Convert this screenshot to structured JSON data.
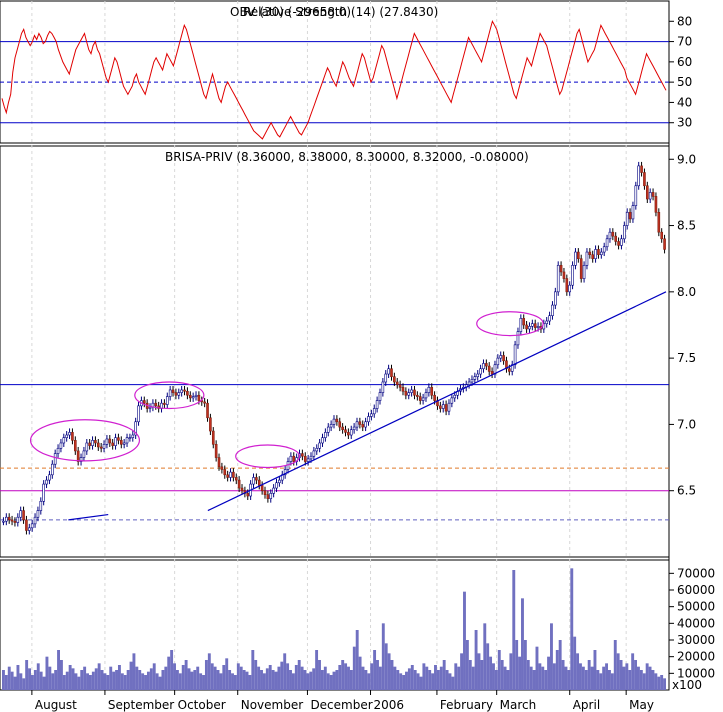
{
  "chart_data": [
    {
      "type": "line",
      "title": "Relative Strength (14) (27.8430)",
      "title_overlap": "OBV (30) (-29658.0)",
      "ylim": [
        20,
        90
      ],
      "yticks": [
        "80",
        "70",
        "60",
        "50",
        "40",
        "30"
      ],
      "reference_lines": [
        {
          "y": 70,
          "style": "solid",
          "color": "#0000c8"
        },
        {
          "y": 50,
          "style": "dashed",
          "color": "#0000c8"
        },
        {
          "y": 30,
          "style": "solid",
          "color": "#0000c8"
        }
      ],
      "series": [
        {
          "color": "#e00000",
          "values": [
            42,
            38,
            35,
            40,
            44,
            55,
            62,
            66,
            70,
            74,
            76,
            72,
            70,
            68,
            70,
            73,
            71,
            74,
            72,
            69,
            70,
            73,
            75,
            74,
            72,
            70,
            66,
            63,
            60,
            58,
            56,
            54,
            58,
            62,
            66,
            68,
            70,
            72,
            74,
            70,
            66,
            64,
            68,
            70,
            66,
            64,
            60,
            56,
            52,
            50,
            54,
            58,
            62,
            60,
            56,
            52,
            48,
            46,
            44,
            46,
            48,
            52,
            54,
            50,
            48,
            46,
            44,
            48,
            52,
            56,
            60,
            62,
            60,
            58,
            56,
            60,
            64,
            62,
            60,
            58,
            62,
            66,
            70,
            74,
            78,
            76,
            72,
            68,
            64,
            60,
            56,
            52,
            48,
            44,
            42,
            46,
            50,
            54,
            50,
            46,
            42,
            40,
            44,
            48,
            50,
            48,
            46,
            44,
            42,
            40,
            38,
            36,
            34,
            32,
            30,
            28,
            26,
            25,
            24,
            23,
            22,
            24,
            26,
            28,
            30,
            28,
            26,
            24,
            23,
            25,
            27,
            29,
            31,
            33,
            31,
            29,
            27,
            25,
            24,
            26,
            28,
            30,
            33,
            36,
            39,
            42,
            45,
            48,
            51,
            54,
            57,
            55,
            52,
            50,
            48,
            52,
            56,
            60,
            58,
            55,
            52,
            50,
            48,
            52,
            56,
            60,
            64,
            62,
            58,
            54,
            50,
            52,
            56,
            60,
            64,
            68,
            66,
            62,
            58,
            54,
            50,
            46,
            42,
            46,
            50,
            54,
            58,
            62,
            66,
            70,
            74,
            72,
            70,
            68,
            66,
            64,
            62,
            60,
            58,
            56,
            54,
            52,
            50,
            48,
            46,
            44,
            42,
            40,
            44,
            48,
            52,
            56,
            60,
            64,
            68,
            72,
            70,
            68,
            66,
            64,
            62,
            60,
            64,
            68,
            72,
            76,
            80,
            78,
            76,
            72,
            68,
            64,
            60,
            56,
            52,
            48,
            44,
            42,
            46,
            50,
            54,
            58,
            62,
            60,
            58,
            62,
            66,
            70,
            74,
            72,
            70,
            68,
            64,
            60,
            56,
            52,
            48,
            44,
            46,
            50,
            54,
            58,
            62,
            66,
            70,
            74,
            76,
            72,
            68,
            64,
            60,
            62,
            64,
            66,
            70,
            74,
            78,
            76,
            74,
            72,
            70,
            68,
            66,
            64,
            62,
            60,
            58,
            56,
            52,
            50,
            48,
            46,
            44,
            48,
            52,
            56,
            60,
            64,
            62,
            60,
            58,
            56,
            54,
            52,
            50,
            48,
            46
          ]
        }
      ]
    },
    {
      "type": "candlestick",
      "title": "BRISA-PRIV (8.36000, 8.38000, 8.30000, 8.32000, -0.08000)",
      "ylim": [
        6.0,
        9.1
      ],
      "yticks": [
        "9.0",
        "8.5",
        "8.0",
        "7.5",
        "7.0",
        "6.5"
      ],
      "reference_lines": [
        {
          "y": 7.3,
          "style": "solid",
          "color": "#0000c8"
        },
        {
          "y": 6.67,
          "style": "dashed",
          "color": "#e07a2a"
        },
        {
          "y": 6.5,
          "style": "solid",
          "color": "#c000c0"
        },
        {
          "y": 6.28,
          "style": "dashed",
          "color": "#6060c0"
        }
      ],
      "trendlines": [
        {
          "from": {
            "xi": 0.1,
            "y": 6.28
          },
          "to": {
            "xi": 0.16,
            "y": 6.32
          }
        },
        {
          "from": {
            "xi": 0.31,
            "y": 6.35
          },
          "to": {
            "xi": 1.0,
            "y": 8.0
          }
        }
      ],
      "series": [
        {
          "name": "close",
          "values": [
            6.27,
            6.3,
            6.28,
            6.27,
            6.26,
            6.3,
            6.35,
            6.28,
            6.2,
            6.22,
            6.25,
            6.3,
            6.35,
            6.42,
            6.55,
            6.58,
            6.62,
            6.7,
            6.78,
            6.82,
            6.86,
            6.9,
            6.92,
            6.94,
            6.88,
            6.8,
            6.72,
            6.75,
            6.8,
            6.86,
            6.84,
            6.88,
            6.86,
            6.83,
            6.82,
            6.85,
            6.89,
            6.86,
            6.84,
            6.9,
            6.88,
            6.85,
            6.86,
            6.9,
            6.9,
            6.92,
            7.02,
            7.14,
            7.18,
            7.16,
            7.12,
            7.13,
            7.16,
            7.14,
            7.12,
            7.16,
            7.15,
            7.21,
            7.26,
            7.24,
            7.22,
            7.24,
            7.26,
            7.25,
            7.22,
            7.2,
            7.21,
            7.22,
            7.18,
            7.17,
            7.16,
            7.05,
            6.95,
            6.85,
            6.75,
            6.68,
            6.66,
            6.62,
            6.6,
            6.64,
            6.6,
            6.58,
            6.52,
            6.5,
            6.48,
            6.46,
            6.55,
            6.6,
            6.58,
            6.54,
            6.5,
            6.47,
            6.44,
            6.48,
            6.52,
            6.56,
            6.58,
            6.62,
            6.66,
            6.72,
            6.76,
            6.72,
            6.75,
            6.78,
            6.76,
            6.72,
            6.74,
            6.76,
            6.8,
            6.82,
            6.86,
            6.9,
            6.94,
            6.98,
            7.0,
            7.04,
            7.02,
            6.98,
            6.96,
            6.94,
            6.92,
            6.96,
            6.98,
            7.02,
            7.0,
            6.98,
            7.02,
            7.06,
            7.08,
            7.12,
            7.18,
            7.24,
            7.32,
            7.38,
            7.42,
            7.36,
            7.32,
            7.3,
            7.28,
            7.25,
            7.22,
            7.24,
            7.26,
            7.22,
            7.21,
            7.18,
            7.2,
            7.24,
            7.28,
            7.22,
            7.18,
            7.14,
            7.12,
            7.15,
            7.1,
            7.16,
            7.2,
            7.22,
            7.25,
            7.27,
            7.28,
            7.3,
            7.32,
            7.34,
            7.36,
            7.38,
            7.42,
            7.46,
            7.44,
            7.4,
            7.38,
            7.45,
            7.5,
            7.52,
            7.48,
            7.42,
            7.4,
            7.45,
            7.6,
            7.7,
            7.8,
            7.75,
            7.72,
            7.74,
            7.76,
            7.73,
            7.74,
            7.72,
            7.76,
            7.78,
            7.82,
            7.9,
            8.0,
            8.2,
            8.15,
            8.1,
            8.0,
            8.05,
            8.2,
            8.3,
            8.25,
            8.1,
            8.2,
            8.3,
            8.28,
            8.25,
            8.32,
            8.28,
            8.3,
            8.34,
            8.4,
            8.45,
            8.42,
            8.38,
            8.35,
            8.4,
            8.5,
            8.6,
            8.55,
            8.65,
            8.8,
            8.95,
            8.9,
            8.8,
            8.7,
            8.75,
            8.72,
            8.6,
            8.45,
            8.4,
            8.32
          ]
        }
      ],
      "ellipses": [
        {
          "center": {
            "xi": 0.125,
            "y": 6.88
          },
          "rx_xi": 0.082,
          "ry_y": 0.155
        },
        {
          "center": {
            "xi": 0.252,
            "y": 7.22
          },
          "rx_xi": 0.052,
          "ry_y": 0.1
        },
        {
          "center": {
            "xi": 0.4,
            "y": 6.76
          },
          "rx_xi": 0.048,
          "ry_y": 0.085
        },
        {
          "center": {
            "xi": 0.765,
            "y": 7.76
          },
          "rx_xi": 0.05,
          "ry_y": 0.09
        }
      ]
    },
    {
      "type": "bar",
      "ylim": [
        0,
        78000
      ],
      "yticks": [
        "70000",
        "60000",
        "50000",
        "40000",
        "30000",
        "20000",
        "10000"
      ],
      "unit_label": "x100",
      "color": "#7070c0",
      "values": [
        12000,
        9000,
        14000,
        11000,
        8000,
        15000,
        10000,
        7000,
        18000,
        13000,
        9000,
        12000,
        16000,
        11000,
        8000,
        20000,
        14000,
        10000,
        12000,
        24000,
        18000,
        9000,
        11000,
        15000,
        13000,
        10000,
        8000,
        12000,
        14000,
        10000,
        9000,
        11000,
        13000,
        16000,
        12000,
        10000,
        9000,
        14000,
        11000,
        12000,
        15000,
        10000,
        9000,
        12000,
        17000,
        22000,
        14000,
        12000,
        10000,
        9000,
        11000,
        13000,
        16000,
        10000,
        8000,
        12000,
        14000,
        20000,
        24000,
        16000,
        12000,
        10000,
        15000,
        18000,
        13000,
        11000,
        12000,
        14000,
        10000,
        9000,
        18000,
        22000,
        16000,
        14000,
        12000,
        10000,
        15000,
        19000,
        12000,
        10000,
        9000,
        16000,
        14000,
        12000,
        11000,
        9000,
        24000,
        18000,
        14000,
        12000,
        10000,
        13000,
        15000,
        12000,
        11000,
        14000,
        17000,
        22000,
        16000,
        12000,
        10000,
        15000,
        18000,
        14000,
        12000,
        10000,
        11000,
        13000,
        24000,
        18000,
        12000,
        14000,
        10000,
        9000,
        11000,
        12000,
        15000,
        18000,
        16000,
        14000,
        12000,
        26000,
        36000,
        20000,
        14000,
        12000,
        10000,
        16000,
        24000,
        18000,
        14000,
        40000,
        28000,
        22000,
        18000,
        14000,
        12000,
        10000,
        9000,
        11000,
        13000,
        15000,
        12000,
        10000,
        8000,
        16000,
        14000,
        12000,
        10000,
        15000,
        12000,
        14000,
        18000,
        12000,
        10000,
        8000,
        16000,
        14000,
        22000,
        59000,
        30000,
        18000,
        14000,
        36000,
        22000,
        18000,
        40000,
        28000,
        20000,
        16000,
        12000,
        24000,
        18000,
        14000,
        12000,
        22000,
        72000,
        30000,
        20000,
        55000,
        30000,
        18000,
        14000,
        12000,
        26000,
        16000,
        14000,
        12000,
        20000,
        40000,
        16000,
        24000,
        30000,
        18000,
        14000,
        12000,
        73000,
        32000,
        22000,
        16000,
        14000,
        12000,
        18000,
        14000,
        24000,
        12000,
        10000,
        14000,
        16000,
        12000,
        10000,
        30000,
        22000,
        18000,
        14000,
        16000,
        12000,
        22000,
        18000,
        14000,
        12000,
        10000,
        16000,
        14000,
        12000,
        10000,
        8000,
        9000,
        7000
      ]
    }
  ],
  "x_axis": {
    "labels": [
      "August",
      "September",
      "October",
      "November",
      "December",
      "2006",
      "February",
      "March",
      "April",
      "May"
    ]
  }
}
